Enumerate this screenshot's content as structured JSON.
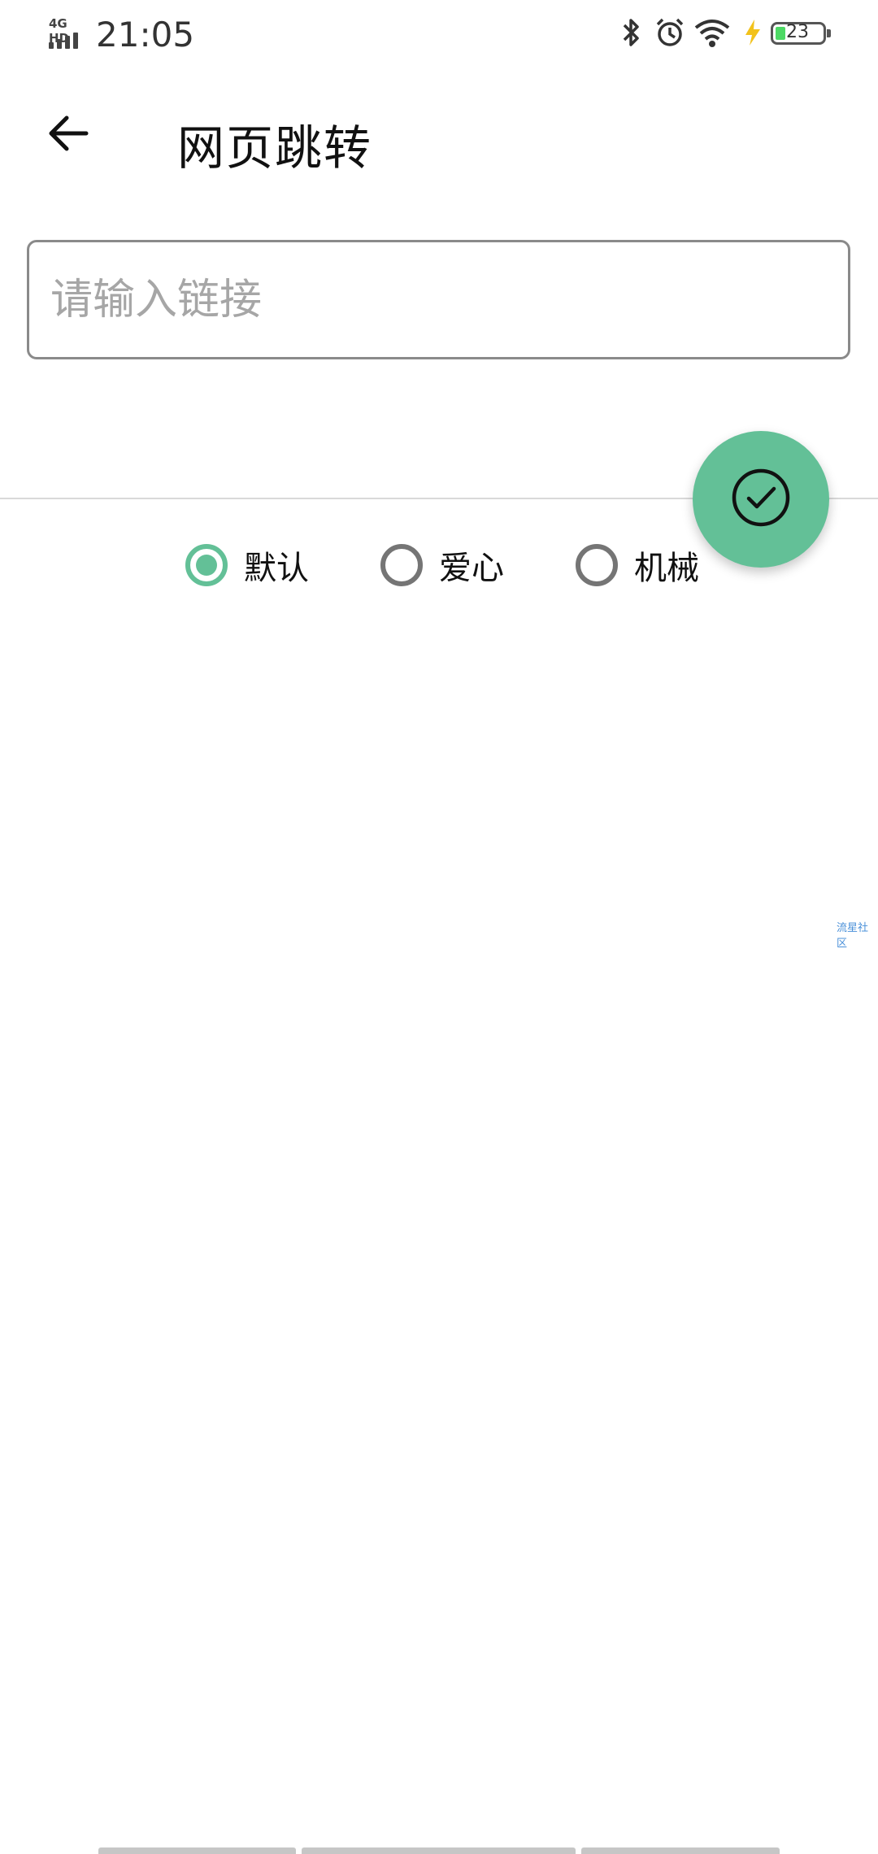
{
  "status_bar": {
    "network": "4G HD",
    "time": "21:05",
    "battery": "23"
  },
  "toolbar": {
    "title": "网页跳转"
  },
  "url_input": {
    "placeholder": "请输入链接",
    "value": ""
  },
  "radio_options": [
    {
      "label": "默认",
      "checked": true
    },
    {
      "label": "爱心",
      "checked": false
    },
    {
      "label": "机械",
      "checked": false
    }
  ],
  "watermark": "流星社区",
  "colors": {
    "accent": "#63c097",
    "radio_unchecked": "#757575",
    "input_border": "#8a8a8a"
  },
  "icons": {
    "back": "arrow-left-icon",
    "fab": "check-circle-icon"
  }
}
